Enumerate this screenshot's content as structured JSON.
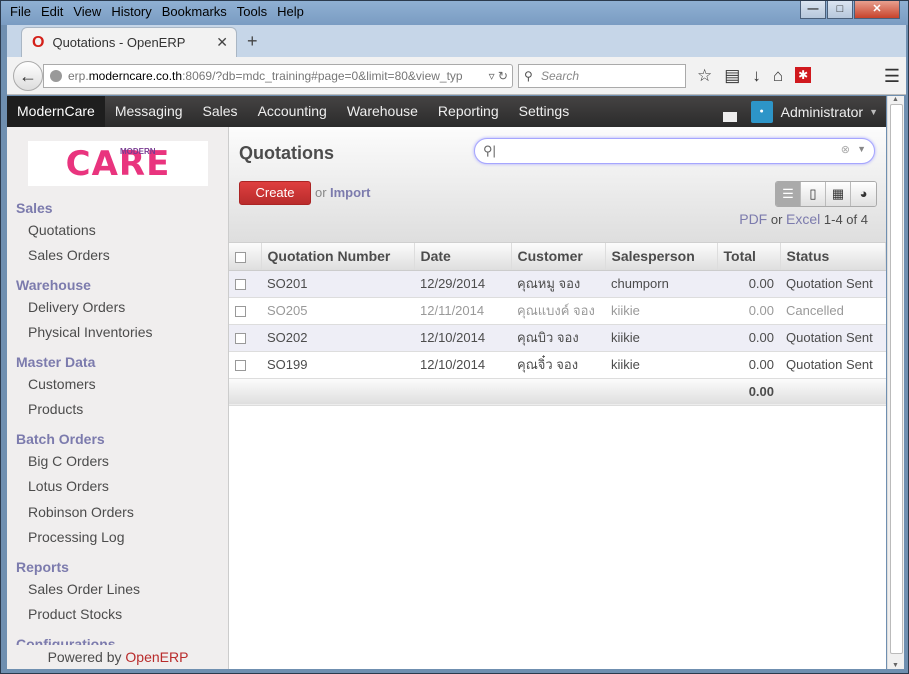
{
  "browser": {
    "menu": [
      "File",
      "Edit",
      "View",
      "History",
      "Bookmarks",
      "Tools",
      "Help"
    ],
    "tab_title": "Quotations - OpenERP",
    "url_prefix": "erp.",
    "url_host": "moderncare.co.th",
    "url_rest": ":8069/?db=mdc_training#page=0&limit=80&view_typ",
    "search_placeholder": "Search"
  },
  "topnav": {
    "items": [
      "ModernCare",
      "Messaging",
      "Sales",
      "Accounting",
      "Warehouse",
      "Reporting",
      "Settings"
    ],
    "user": "Administrator"
  },
  "sidebar": {
    "logo_text": "CARE",
    "logo_small": "MODERN",
    "sections": [
      {
        "title": "Sales",
        "items": [
          "Quotations",
          "Sales Orders"
        ]
      },
      {
        "title": "Warehouse",
        "items": [
          "Delivery Orders",
          "Physical Inventories"
        ]
      },
      {
        "title": "Master Data",
        "items": [
          "Customers",
          "Products"
        ]
      },
      {
        "title": "Batch Orders",
        "items": [
          "Big C Orders",
          "Lotus Orders",
          "Robinson Orders",
          "Processing Log"
        ]
      },
      {
        "title": "Reports",
        "items": [
          "Sales Order Lines",
          "Product Stocks"
        ]
      },
      {
        "title": "Configurations",
        "items": []
      }
    ],
    "powered_prefix": "Powered by ",
    "powered_brand": "OpenERP"
  },
  "main": {
    "title": "Quotations",
    "create_label": "Create",
    "or_label": "or",
    "import_label": "Import",
    "pager": {
      "pdf": "PDF",
      "or": "or",
      "excel": "Excel",
      "range": "1-4 of 4"
    },
    "columns": [
      "Quotation Number",
      "Date",
      "Customer",
      "Salesperson",
      "Total",
      "Status"
    ],
    "rows": [
      {
        "number": "SO201",
        "date": "12/29/2014",
        "customer": "คุณหมู จอง",
        "salesperson": "chumporn",
        "total": "0.00",
        "status": "Quotation Sent"
      },
      {
        "number": "SO205",
        "date": "12/11/2014",
        "customer": "คุณแบงค์ จอง",
        "salesperson": "kiikie",
        "total": "0.00",
        "status": "Cancelled"
      },
      {
        "number": "SO202",
        "date": "12/10/2014",
        "customer": "คุณบิว จอง",
        "salesperson": "kiikie",
        "total": "0.00",
        "status": "Quotation Sent"
      },
      {
        "number": "SO199",
        "date": "12/10/2014",
        "customer": "คุณจิ๋ว จอง",
        "salesperson": "kiikie",
        "total": "0.00",
        "status": "Quotation Sent"
      }
    ],
    "footer_total": "0.00"
  },
  "colors": {
    "accent": "#7c7bad",
    "create": "#d23b3b",
    "brand": "#e9347e"
  }
}
